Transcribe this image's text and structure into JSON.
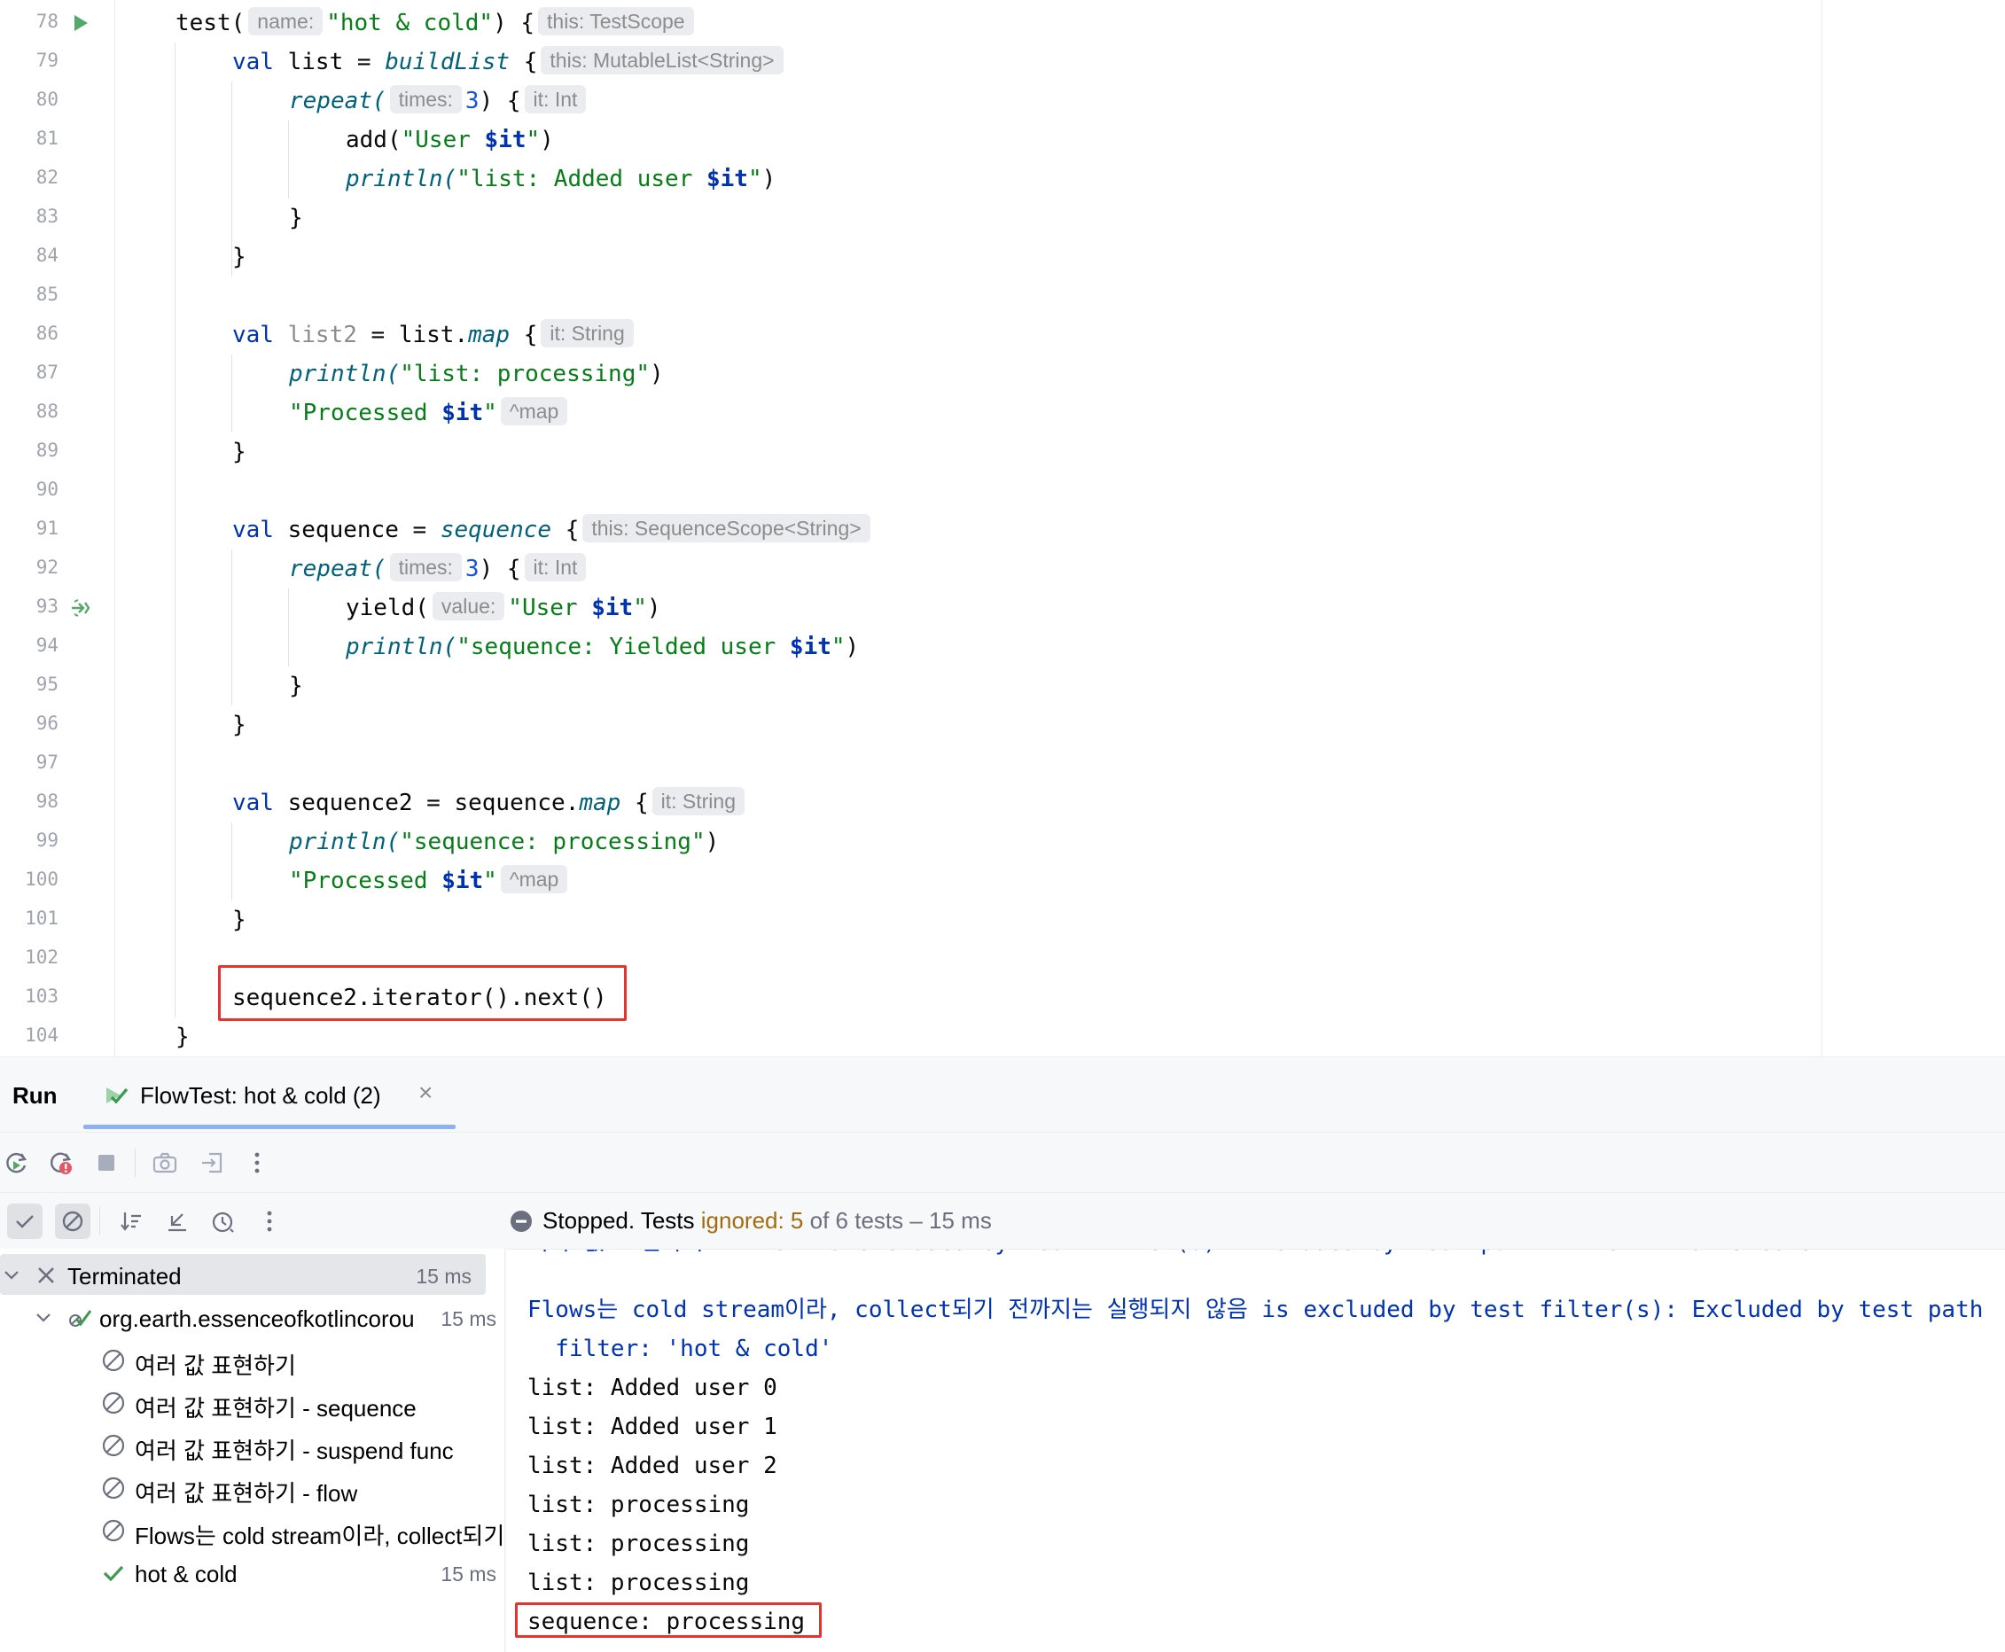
{
  "editor": {
    "lines": [
      {
        "n": "78"
      },
      {
        "n": "79"
      },
      {
        "n": "80"
      },
      {
        "n": "81"
      },
      {
        "n": "82"
      },
      {
        "n": "83"
      },
      {
        "n": "84"
      },
      {
        "n": "85"
      },
      {
        "n": "86"
      },
      {
        "n": "87"
      },
      {
        "n": "88"
      },
      {
        "n": "89"
      },
      {
        "n": "90"
      },
      {
        "n": "91"
      },
      {
        "n": "92"
      },
      {
        "n": "93"
      },
      {
        "n": "94"
      },
      {
        "n": "95"
      },
      {
        "n": "96"
      },
      {
        "n": "97"
      },
      {
        "n": "98"
      },
      {
        "n": "99"
      },
      {
        "n": "100"
      },
      {
        "n": "101"
      },
      {
        "n": "102"
      },
      {
        "n": "103"
      },
      {
        "n": "104"
      }
    ],
    "code": {
      "l78": {
        "fn": "test(",
        "hint1": "name:",
        "s": "\"hot & cold\"",
        "rest": ") {",
        "hint2": "this: TestScope"
      },
      "l79": {
        "kw": "val",
        "name": " list = ",
        "fn": "buildList",
        "rest": " {",
        "hint": "this: MutableList<String>"
      },
      "l80": {
        "fn": "repeat(",
        "hint1": "times:",
        "num": "3",
        "rest": ") {",
        "hint2": "it: Int"
      },
      "l81": {
        "a": "add(",
        "s1": "\"User ",
        "it": "$it",
        "s2": "\"",
        "b": ")"
      },
      "l82": {
        "fn": "println(",
        "s1": "\"list: Added user ",
        "it": "$it",
        "s2": "\"",
        "b": ")"
      },
      "l83": "}",
      "l84": "}",
      "l86": {
        "kw": "val",
        "name": " list2",
        "eq": " = list.",
        "fn": "map",
        "rest": " {",
        "hint": "it: String"
      },
      "l87": {
        "fn": "println(",
        "s": "\"list: processing\"",
        "b": ")"
      },
      "l88": {
        "s1": "\"Processed ",
        "it": "$it",
        "s2": "\"",
        "hint": "^map"
      },
      "l89": "}",
      "l91": {
        "kw": "val",
        "name": " sequence = ",
        "fn": "sequence",
        "rest": " {",
        "hint": "this: SequenceScope<String>"
      },
      "l92": {
        "fn": "repeat(",
        "hint1": "times:",
        "num": "3",
        "rest": ") {",
        "hint2": "it: Int"
      },
      "l93": {
        "a": "yield(",
        "hint": "value:",
        "s1": "\"User ",
        "it": "$it",
        "s2": "\"",
        "b": ")"
      },
      "l94": {
        "fn": "println(",
        "s1": "\"sequence: Yielded user ",
        "it": "$it",
        "s2": "\"",
        "b": ")"
      },
      "l95": "}",
      "l96": "}",
      "l98": {
        "kw": "val",
        "name": " sequence2 = sequence.",
        "fn": "map",
        "rest": " {",
        "hint": "it: String"
      },
      "l99": {
        "fn": "println(",
        "s": "\"sequence: processing\"",
        "b": ")"
      },
      "l100": {
        "s1": "\"Processed ",
        "it": "$it",
        "s2": "\"",
        "hint": "^map"
      },
      "l101": "}",
      "l103": "sequence2.iterator().next()",
      "l104": "}"
    }
  },
  "run": {
    "title": "Run",
    "tab_label": "FlowTest: hot & cold (2)",
    "tab_close": "×",
    "status": {
      "prefix": "Stopped. Tests ",
      "ignored": "ignored: 5",
      "suffix": " of 6 tests – 15 ms"
    },
    "tree": [
      {
        "label": "Terminated",
        "time": "15 ms"
      },
      {
        "label": "org.earth.essenceofkotlincorou",
        "time": "15 ms"
      },
      {
        "label": "여러 값 표현하기"
      },
      {
        "label": "여러 값 표현하기 - sequence"
      },
      {
        "label": "여러 값 표현하기 - suspend func"
      },
      {
        "label": "여러 값 표현하기 - flow"
      },
      {
        "label": "Flows는 cold stream이라, collect되기"
      },
      {
        "label": "hot & cold",
        "time": "15 ms"
      }
    ],
    "console": {
      "cut_line": "여러 값 표현하기 - flow is excluded by test filter(s): Excluded by test path filter: 'hot & cold'",
      "sys1": "Flows는 cold stream이라, collect되기 전까지는 실행되지 않음 is excluded by test filter(s): Excluded by test path",
      "sys2": "  filter: 'hot & cold'",
      "lines": [
        "list: Added user 0",
        "list: Added user 1",
        "list: Added user 2",
        "list: processing",
        "list: processing",
        "list: processing",
        "sequence: processing"
      ]
    }
  }
}
